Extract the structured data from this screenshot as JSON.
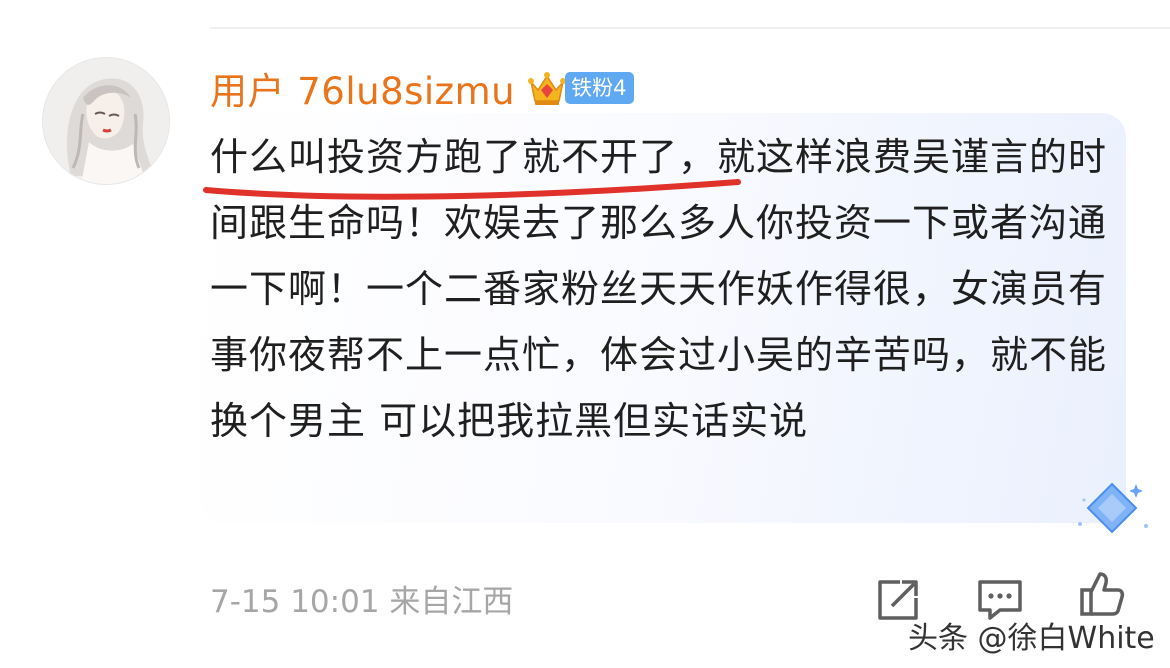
{
  "user": {
    "name": "用户 76lu8sizmu",
    "badge_label": "铁粉4",
    "name_color": "#e8741b",
    "badge_color": "#5fa8f2"
  },
  "comment": {
    "text": "什么叫投资方跑了就不开了，就这样浪费吴谨言的时间跟生命吗！欢娱去了那么多人你投资一下或者沟通一下啊！一个二番家粉丝天天作妖作得很，女演员有事你夜帮不上一点忙，体会过小吴的辛苦吗，就不能换个男主 可以把我拉黑但实话实说",
    "highlighted_phrase": "什么叫投资方跑了就不开了",
    "underline_color": "#e0322a"
  },
  "meta": {
    "time_location": "7-15 10:01 来自江西"
  },
  "actions": [
    {
      "name": "share",
      "icon": "share-icon"
    },
    {
      "name": "comment",
      "icon": "comment-icon"
    },
    {
      "name": "like",
      "icon": "thumbs-up-icon"
    }
  ],
  "watermark": {
    "text": "头条 @徐白White"
  }
}
